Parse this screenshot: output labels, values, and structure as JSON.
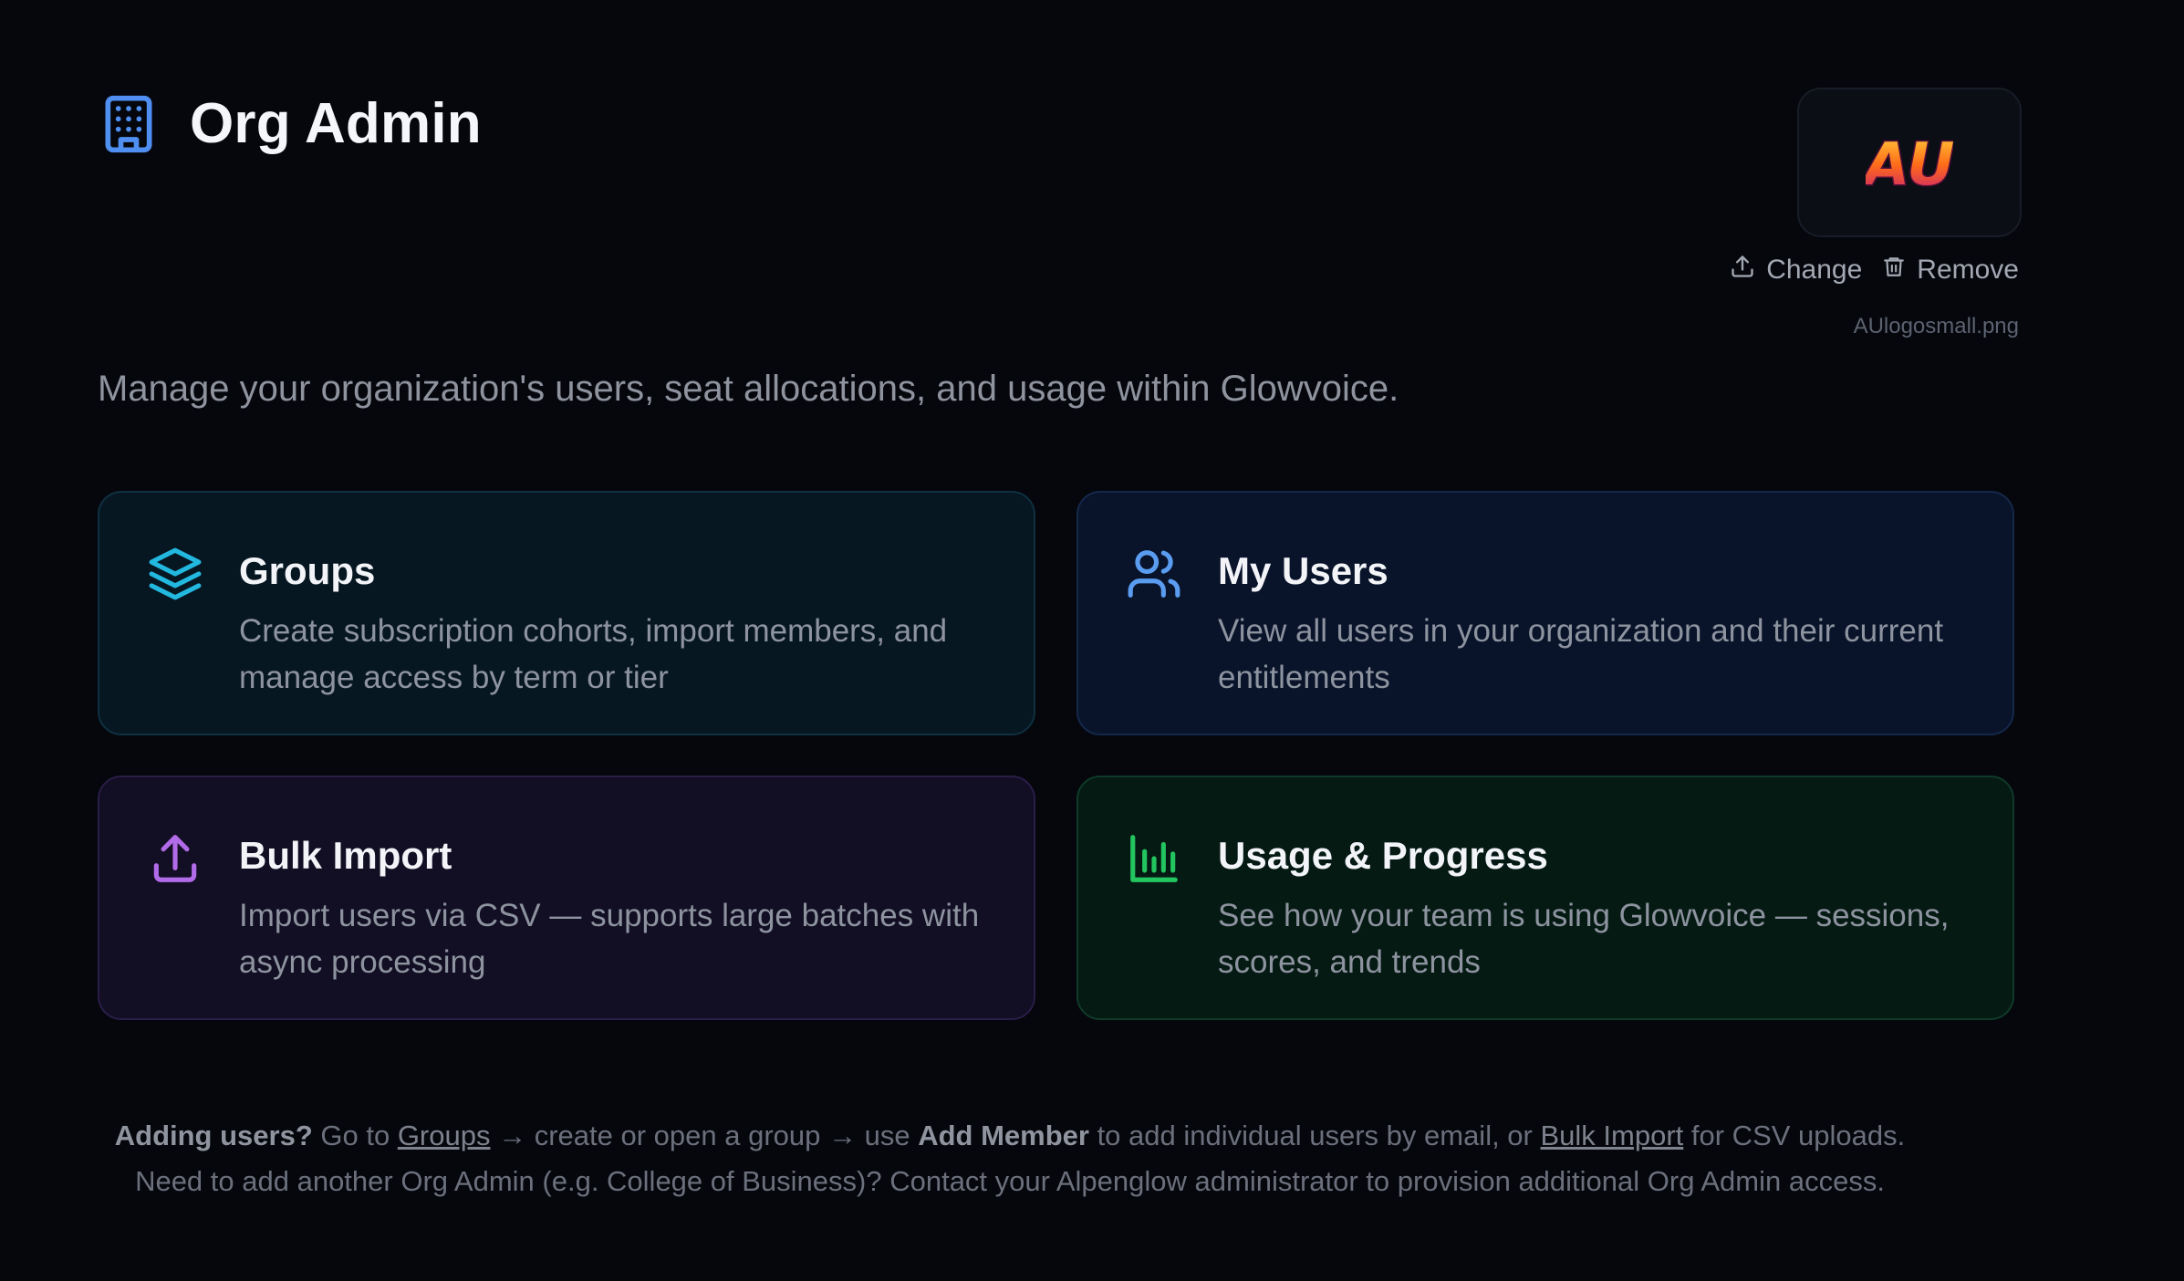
{
  "header": {
    "title": "Org Admin",
    "icon": "building-icon"
  },
  "logo": {
    "text": "AU",
    "change_label": "Change",
    "remove_label": "Remove",
    "filename": "AUlogosmall.png"
  },
  "subtitle": "Manage your organization's users, seat allocations, and usage within Glowvoice.",
  "cards": [
    {
      "title": "Groups",
      "description": "Create subscription cohorts, import members, and manage access by term or tier",
      "icon": "layers-icon",
      "accent": "#22b8e0"
    },
    {
      "title": "My Users",
      "description": "View all users in your organization and their current entitlements",
      "icon": "users-icon",
      "accent": "#5a9cf0"
    },
    {
      "title": "Bulk Import",
      "description": "Import users via CSV — supports large batches with async processing",
      "icon": "upload-icon",
      "accent": "#b26be8"
    },
    {
      "title": "Usage & Progress",
      "description": "See how your team is using Glowvoice — sessions, scores, and trends",
      "icon": "bar-chart-icon",
      "accent": "#22c55e"
    }
  ],
  "footer": {
    "lead": "Adding users?",
    "t1": " Go to ",
    "groups_link": "Groups",
    "t2": " → create or open a group → use ",
    "add_member": "Add Member",
    "t3": " to add individual users by email, or ",
    "bulk_link": "Bulk Import",
    "t4": " for CSV uploads.",
    "line2": "Need to add another Org Admin (e.g. College of Business)? Contact your Alpenglow administrator to provision additional Org Admin access."
  }
}
